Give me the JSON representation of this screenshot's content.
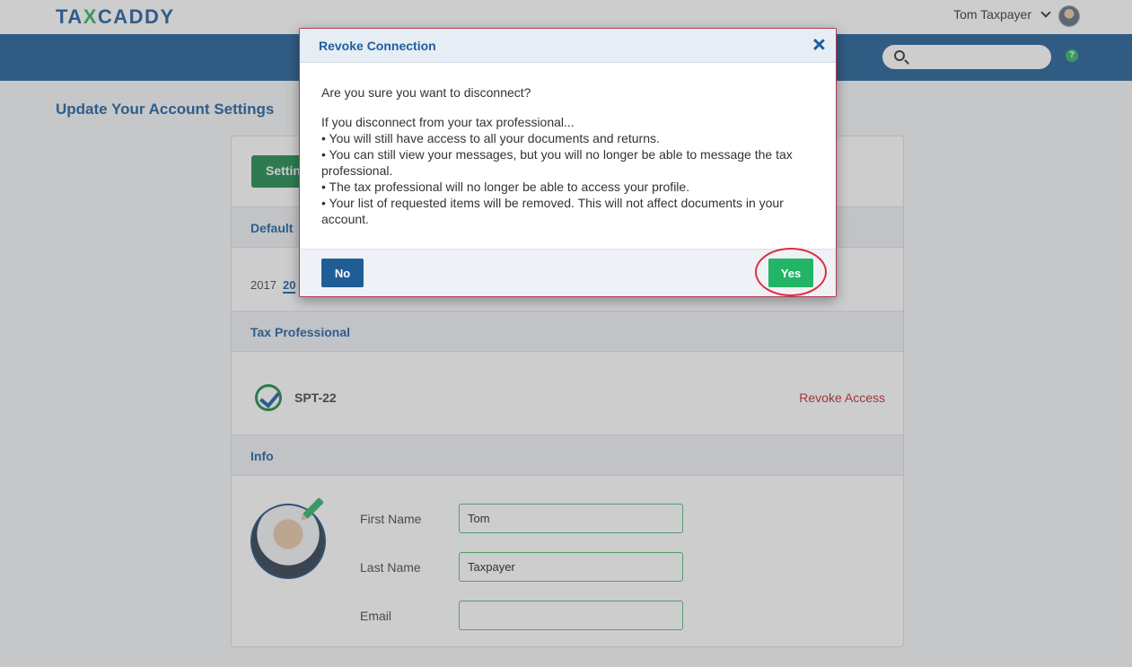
{
  "header": {
    "logo_prefix": "TA",
    "logo_x": "X",
    "logo_suffix": "CADDY",
    "user_name": "Tom Taxpayer",
    "help_label": "?"
  },
  "page": {
    "title": "Update Your Account Settings"
  },
  "card": {
    "settings_button": "Settin",
    "default_section": "Default",
    "years": [
      "2017",
      "20"
    ],
    "tax_professional_section": "Tax Professional",
    "professional_name": "SPT-22",
    "revoke_link": "Revoke Access",
    "info_section": "Info",
    "fields": {
      "first_name_label": "First Name",
      "first_name_value": "Tom",
      "last_name_label": "Last Name",
      "last_name_value": "Taxpayer",
      "email_label": "Email",
      "email_value": ""
    }
  },
  "modal": {
    "title": "Revoke Connection",
    "question": "Are you sure you want to disconnect?",
    "intro": "If you disconnect from your tax professional...",
    "bullets": [
      "• You will still have access to all your documents and returns.",
      "• You can still view your messages, but you will no longer be able to message the tax professional.",
      "• The tax professional will no longer be able to access your profile.",
      "• Your list of requested items will be removed. This will not affect documents in your account."
    ],
    "no_label": "No",
    "yes_label": "Yes"
  },
  "colors": {
    "brand_blue": "#1f5d96",
    "brand_green": "#22b565",
    "revoke_red": "#c0262d",
    "annotation_red": "#d9313d"
  }
}
